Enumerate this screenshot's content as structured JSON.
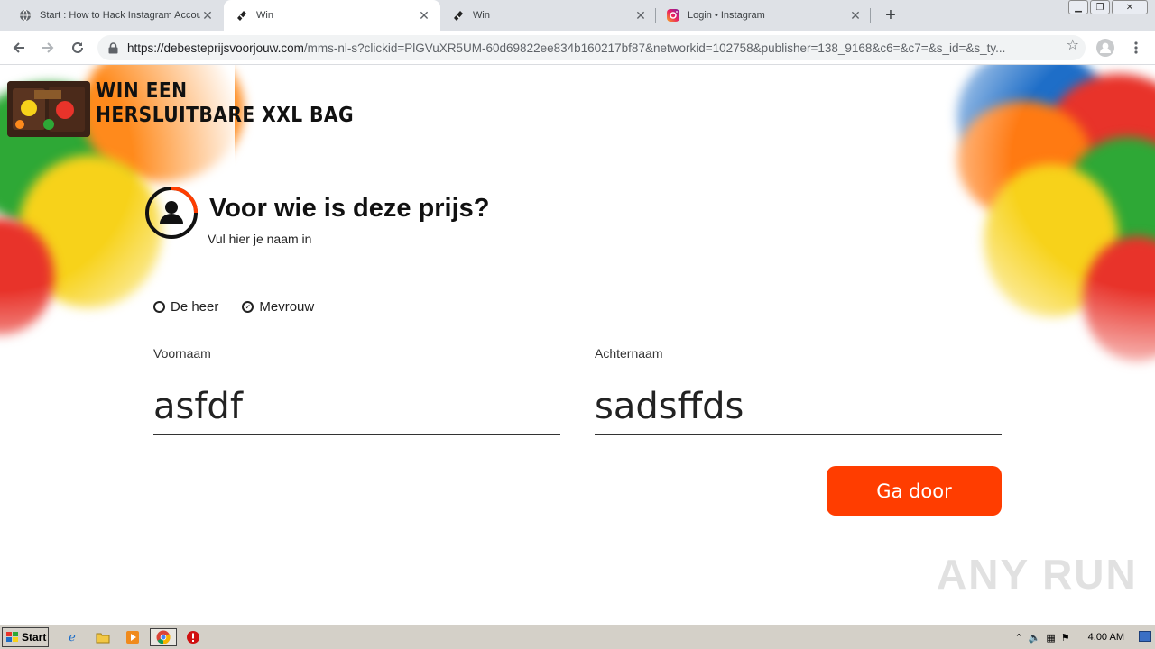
{
  "browser": {
    "tabs": [
      {
        "title": "Start : How to Hack Instagram Accou",
        "icon": "globe-icon"
      },
      {
        "title": "Win",
        "icon": "ticket-icon"
      },
      {
        "title": "Win",
        "icon": "ticket-icon"
      },
      {
        "title": "Login • Instagram",
        "icon": "instagram-icon"
      }
    ],
    "active_tab": 1,
    "url_host": "https://debesteprijsvoorjouw.com",
    "url_path": "/mms-nl-s?clickid=PlGVuXR5UM-60d69822ee834b160217bf87&networkid=102758&publisher=138_9168&c6=&c7=&s_id=&s_ty..."
  },
  "page": {
    "promo_line1": "WIN EEN",
    "promo_line2": "HERSLUITBARE XXL BAG",
    "heading": "Voor wie is deze prijs?",
    "subheading": "Vul hier je naam in",
    "gender_options": [
      {
        "label": "De heer",
        "checked": false
      },
      {
        "label": "Mevrouw",
        "checked": true
      }
    ],
    "first_name_label": "Voornaam",
    "first_name_value": "asfdf",
    "last_name_label": "Achternaam",
    "last_name_value": "sadsffds",
    "submit_label": "Ga door",
    "accent_color": "#ff3d00",
    "watermark": "ANY RUN"
  },
  "taskbar": {
    "start_label": "Start",
    "clock": "4:00 AM"
  }
}
